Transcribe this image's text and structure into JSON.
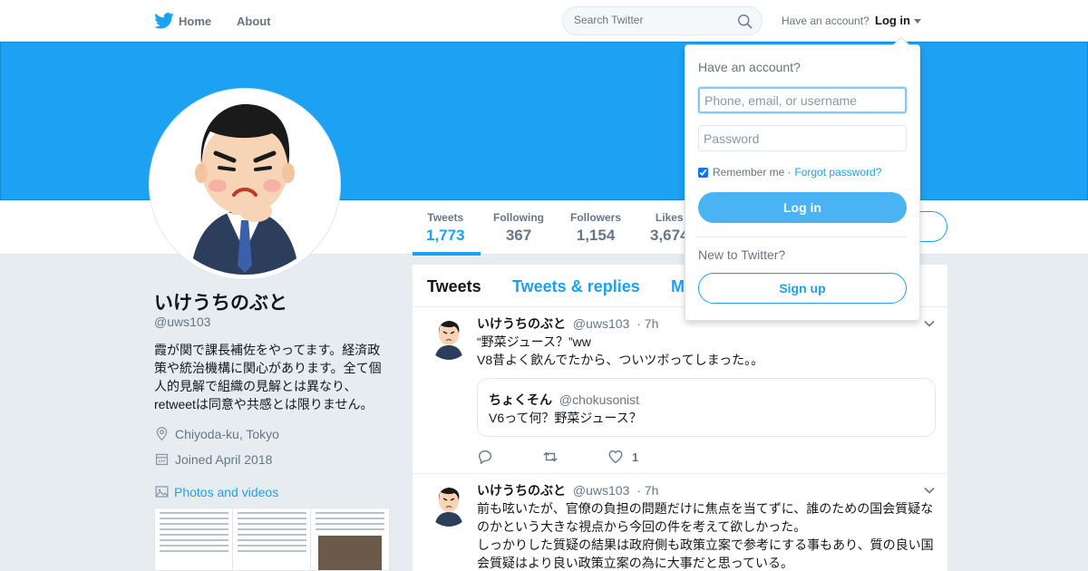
{
  "nav": {
    "home_label": "Home",
    "about_label": "About",
    "search_placeholder": "Search Twitter",
    "have_account": "Have an account?",
    "login_label": "Log in"
  },
  "profile_nav": {
    "stats": [
      {
        "label": "Tweets",
        "value": "1,773"
      },
      {
        "label": "Following",
        "value": "367"
      },
      {
        "label": "Followers",
        "value": "1,154"
      },
      {
        "label": "Likes",
        "value": "3,674"
      }
    ]
  },
  "profile": {
    "name": "いけうちのぶと",
    "handle": "@uws103",
    "bio": "霞が関で課長補佐をやってます。経済政策や統治機構に関心があります。全て個人的見解で組織の見解とは異なり、retweetは同意や共感とは限りません。",
    "location": "Chiyoda-ku, Tokyo",
    "joined": "Joined April 2018",
    "photos_label": "Photos and videos"
  },
  "timeline": {
    "tabs": [
      "Tweets",
      "Tweets & replies",
      "M"
    ],
    "tweets": [
      {
        "name": "いけうちのぶと",
        "handle": "@uws103",
        "time": "· 7h",
        "line1": "“野菜ジュース？”ww",
        "line2": "V8昔よく飲んでたから、ついツボってしまった。。",
        "quote_name": "ちょくそん",
        "quote_handle": "@chokusonist",
        "quote_text": "V6って何？野菜ジュース？",
        "like_count": "1"
      },
      {
        "name": "いけうちのぶと",
        "handle": "@uws103",
        "time": "· 7h",
        "text": "前も呟いたが、官僚の負担の問題だけに焦点を当てずに、誰のための国会質疑なのかという大きな視点から今回の件を考えて欲しかった。\nしっかりした質疑の結果は政府側も政策立案で参考にする事もあり、質の良い国会質疑はより良い政策立案の為に大事だと思っている。"
      }
    ]
  },
  "login_dropdown": {
    "title": "Have an account?",
    "username_placeholder": "Phone, email, or username",
    "password_placeholder": "Password",
    "remember_label": "Remember me",
    "separator": "·",
    "forgot_label": "Forgot password?",
    "login_button": "Log in",
    "new_label": "New to Twitter?",
    "signup_button": "Sign up"
  },
  "colors": {
    "brand_blue": "#1da1f2",
    "banner": "#1da1f2",
    "background": "#e6ecf0"
  }
}
